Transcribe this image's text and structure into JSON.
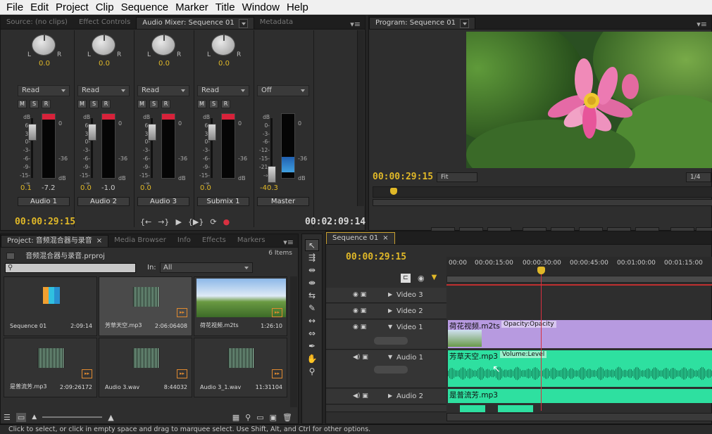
{
  "menu": [
    "File",
    "Edit",
    "Project",
    "Clip",
    "Sequence",
    "Marker",
    "Title",
    "Window",
    "Help"
  ],
  "source_panel": {
    "tabs": [
      "Source: (no clips)",
      "Effect Controls",
      "Audio Mixer: Sequence 01",
      "Metadata"
    ],
    "timecode_left": "00:00:29:15",
    "timecode_right": "00:02:09:14",
    "channels": [
      {
        "name": "Audio 1",
        "pan": "0.0",
        "auto": "Read",
        "vol": "0.1",
        "level": "-7.2"
      },
      {
        "name": "Audio 2",
        "pan": "0.0",
        "auto": "Read",
        "vol": "0.0",
        "level": "-1.0"
      },
      {
        "name": "Audio 3",
        "pan": "0.0",
        "auto": "Read",
        "vol": "0.0",
        "level": ""
      },
      {
        "name": "Submix 1",
        "pan": "0.0",
        "auto": "Read",
        "vol": "0.0",
        "level": ""
      },
      {
        "name": "Master",
        "pan": "",
        "auto": "Off",
        "vol": "-40.3",
        "level": ""
      }
    ],
    "db_scale": [
      "dB",
      "6-",
      "3-",
      "0-",
      "-3-",
      "-6-",
      "-9-",
      "-15-",
      "-∞"
    ],
    "master_scale": [
      "dB",
      "0-",
      "-3-",
      "-6-",
      "-12-",
      "-15-",
      "-21-",
      "-∞"
    ],
    "meter_labels": {
      "top": "0",
      "mid": "-36",
      "bottom": "dB"
    },
    "lr": {
      "l": "L",
      "r": "R"
    },
    "msr": [
      "M",
      "S",
      "R"
    ]
  },
  "program_panel": {
    "tab": "Program: Sequence 01",
    "timecode": "00:00:29:15",
    "fit": "Fit",
    "ratio": "1/4"
  },
  "project_panel": {
    "tabs": [
      "Project: 音频混合器与录音",
      "Media Browser",
      "Info",
      "Effects",
      "Markers"
    ],
    "project_file": "音频混合器与录音.prproj",
    "item_count": "6 Items",
    "in_label": "In:",
    "in_value": "All",
    "items": [
      {
        "name": "Sequence 01",
        "duration": "2:09:14"
      },
      {
        "name": "芳草天空.mp3",
        "duration": "2:06:06408"
      },
      {
        "name": "荷花视频.m2ts",
        "duration": "1:26:10"
      },
      {
        "name": "是普流芳.mp3",
        "duration": "2:09:26172"
      },
      {
        "name": "Audio 3.wav",
        "duration": "8:44032"
      },
      {
        "name": "Audio 3_1.wav",
        "duration": "11:31104"
      }
    ]
  },
  "timeline": {
    "tab": "Sequence 01",
    "timecode": "00:00:29:15",
    "ruler": [
      "00:00",
      "00:00:15:00",
      "00:00:30:00",
      "00:00:45:00",
      "00:01:00:00",
      "00:01:15:00"
    ],
    "tracks": [
      "Video 3",
      "Video 2",
      "Video 1",
      "Audio 1",
      "Audio 2"
    ],
    "clips": {
      "video1": {
        "label": "荷花视频.m2ts",
        "fx": "Opacity:Opacity"
      },
      "audio1": {
        "label": "芳草天空.mp3",
        "fx": "Volume:Level"
      },
      "audio2": {
        "label": "是普流芳.mp3"
      }
    }
  },
  "status_bar": "Click to select, or click in empty space and drag to marquee select. Use Shift, Alt, and Ctrl for other options.",
  "colors": {
    "timecode": "#e0b828",
    "video_clip": "#b79ae0",
    "audio_clip": "#2ee0a0",
    "playhead": "#d83040"
  }
}
